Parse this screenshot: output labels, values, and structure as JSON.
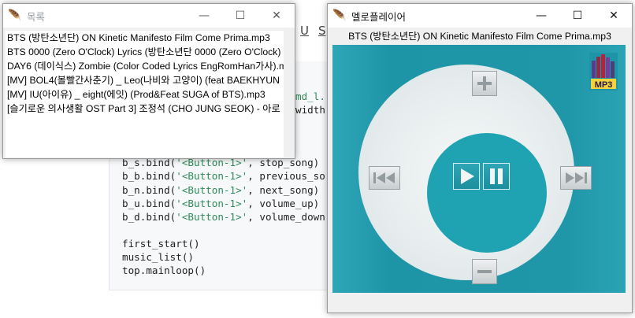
{
  "editor": {
    "format_marks": [
      "U",
      "S"
    ],
    "fragments": {
      "partial_1": "md_l.",
      "partial_2": "width"
    },
    "lines": [
      {
        "pre": "",
        "str": "",
        "post": ""
      },
      {
        "pre": "",
        "str": "",
        "post": ""
      },
      {
        "pre": "",
        "str": "",
        "post": ""
      },
      {
        "pre": "",
        "str": "",
        "post": "ong)"
      },
      {
        "pre": "b_s.bind(",
        "str": "'<Button-1>'",
        "post": ", stop_song)"
      },
      {
        "pre": "b_b.bind(",
        "str": "'<Button-1>'",
        "post": ", previous_so"
      },
      {
        "pre": "b_n.bind(",
        "str": "'<Button-1>'",
        "post": ", next_song)"
      },
      {
        "pre": "b_u.bind(",
        "str": "'<Button-1>'",
        "post": ", volume_up)"
      },
      {
        "pre": "b_d.bind(",
        "str": "'<Button-1>'",
        "post": ", volume_down"
      },
      {
        "pre": "",
        "str": "",
        "post": ""
      },
      {
        "pre": "first_start()",
        "str": "",
        "post": ""
      },
      {
        "pre": "music_list()",
        "str": "",
        "post": ""
      },
      {
        "pre": "top.mainloop()",
        "str": "",
        "post": ""
      }
    ]
  },
  "list_window": {
    "title": "목록",
    "items": [
      "BTS (방탄소년단) ON Kinetic Manifesto Film  Come Prima.mp3",
      "BTS 0000 (Zero O'Clock) Lyrics (방탄소년단 0000 (Zero O'Clock)",
      "DAY6 (데이식스) Zombie (Color Coded Lyrics EngRomHan가사).m",
      "[MV] BOL4(볼빨간사춘기) _ Leo(나비와 고양이) (feat BAEKHYUN",
      "[MV] IU(아이유) _ eight(에잇) (Prod&Feat SUGA of BTS).mp3",
      "[슬기로운 의사생활 OST Part 3] 조정석 (CHO JUNG SEOK) - 아로"
    ]
  },
  "player_window": {
    "title": "멜로플레이어",
    "now_playing": "BTS (방탄소년단) ON Kinetic Manifesto Film  Come Prima.mp3",
    "mp3_badge": "MP3"
  },
  "icons": {
    "app": "feather-icon",
    "minimize": "minimize-icon",
    "maximize": "maximize-icon",
    "close": "close-icon"
  },
  "colors": {
    "accent_teal": "#1e95a7",
    "wheel": "#eef2f3"
  }
}
